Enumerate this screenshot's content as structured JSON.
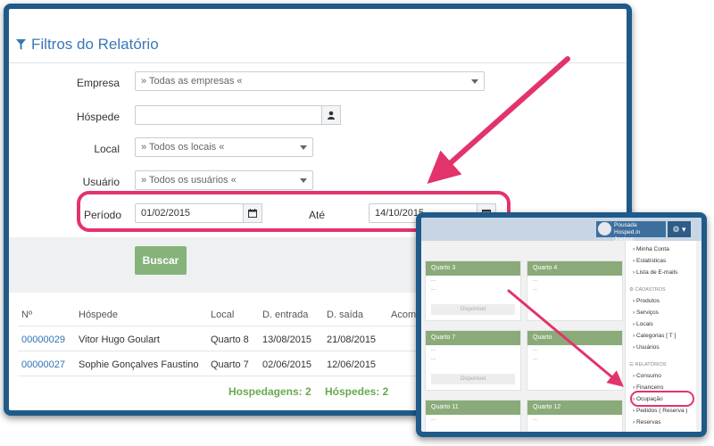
{
  "filters": {
    "title": "Filtros do Relatório",
    "empresa": {
      "label": "Empresa",
      "value": "» Todas as empresas «"
    },
    "hospede": {
      "label": "Hóspede",
      "value": ""
    },
    "local": {
      "label": "Local",
      "value": "» Todos os locais «"
    },
    "usuario": {
      "label": "Usuário",
      "value": "» Todos os usuários «"
    },
    "periodo": {
      "label": "Período",
      "start": "01/02/2015",
      "ate_label": "Até",
      "end": "14/10/2015"
    },
    "search_button": "Buscar"
  },
  "table": {
    "headers": [
      "Nº",
      "Hóspede",
      "Local",
      "D. entrada",
      "D. saída",
      "Acomp"
    ],
    "rows": [
      {
        "num": "00000029",
        "hospede": "Vitor Hugo Goulart",
        "local": "Quarto 8",
        "entrada": "13/08/2015",
        "saida": "21/08/2015"
      },
      {
        "num": "00000027",
        "hospede": "Sophie Gonçalves Faustino",
        "local": "Quarto 7",
        "entrada": "02/06/2015",
        "saida": "12/06/2015"
      }
    ],
    "totals": {
      "hospedagens": "Hospedagens: 2",
      "hospedes": "Hóspedes: 2"
    }
  },
  "inset": {
    "user_line1": "Pousada Hosped.in",
    "user_line2": "Joelson",
    "rooms": [
      {
        "name": "Quarto 3",
        "status": "Disponível"
      },
      {
        "name": "Quarto 4",
        "status": ""
      },
      {
        "name": "Quarto 7",
        "status": "Disponível"
      },
      {
        "name": "Quarto",
        "status": ""
      },
      {
        "name": "Quarto 11",
        "status": ""
      },
      {
        "name": "Quarto 12",
        "status": ""
      }
    ],
    "room_placeholder": "...",
    "menu": {
      "top_items": [
        "Minha Conta",
        "Estatísticas",
        "Lista de E-mails"
      ],
      "cadastros_label": "CADASTROS",
      "cadastros_items": [
        "Produtos",
        "Serviços",
        "Locais",
        "Categorias [ T ]",
        "Usuários"
      ],
      "relatorios_label": "RELATÓRIOS",
      "relatorios_items": [
        "Consumo",
        "Financeiro",
        "Ocupação",
        "Pedidos ( Reserva )",
        "Reservas"
      ]
    }
  },
  "colors": {
    "accent_pink": "#e3336b",
    "frame_blue": "#1f5a8a",
    "title_blue": "#3a78b5",
    "button_green": "#86b37a",
    "total_green": "#6aa850"
  }
}
